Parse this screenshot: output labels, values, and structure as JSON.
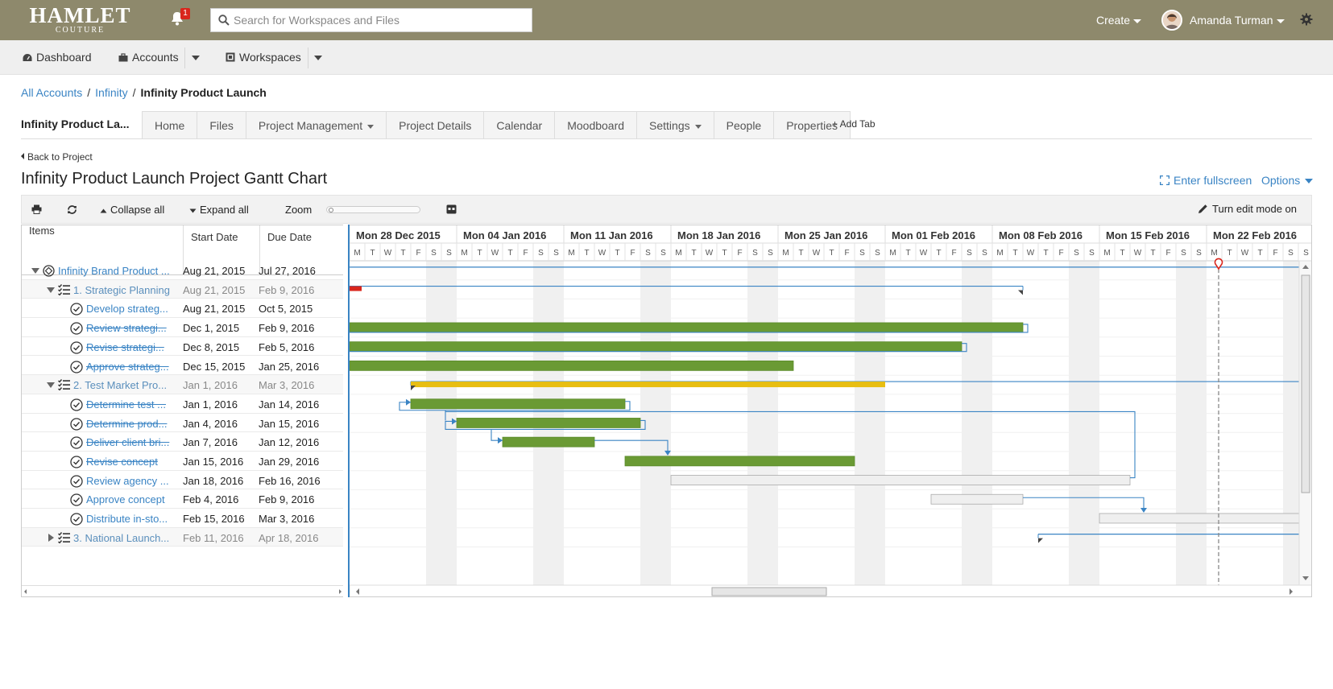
{
  "brand": {
    "line1": "HAMLET",
    "line2": "COUTURE"
  },
  "header": {
    "notifications_count": "1",
    "search_placeholder": "Search for Workspaces and Files",
    "create_label": "Create",
    "user_name": "Amanda Turman",
    "bar_color": "#8e896c"
  },
  "nav": {
    "dashboard": "Dashboard",
    "accounts": "Accounts",
    "workspaces": "Workspaces"
  },
  "breadcrumb": {
    "all_accounts": "All Accounts",
    "infinity": "Infinity",
    "current": "Infinity Product Launch"
  },
  "project": {
    "name": "Infinity Product La..."
  },
  "tabs": [
    {
      "label": "Home",
      "dropdown": false
    },
    {
      "label": "Files",
      "dropdown": false
    },
    {
      "label": "Project Management",
      "dropdown": true
    },
    {
      "label": "Project Details",
      "dropdown": false
    },
    {
      "label": "Calendar",
      "dropdown": false
    },
    {
      "label": "Moodboard",
      "dropdown": false
    },
    {
      "label": "Settings",
      "dropdown": true
    },
    {
      "label": "People",
      "dropdown": false
    },
    {
      "label": "Properties",
      "dropdown": false
    }
  ],
  "add_tab": "+ Add Tab",
  "back_link": "Back to Project",
  "page_title": "Infinity Product Launch Project Gantt Chart",
  "fullscreen": "Enter fullscreen",
  "options": "Options",
  "toolbar": {
    "collapse": "Collapse all",
    "expand": "Expand all",
    "zoom": "Zoom",
    "zoom_level": 0,
    "edit_mode": "Turn edit mode on"
  },
  "grid": {
    "headers": {
      "items": "Items",
      "start": "Start Date",
      "due": "Due Date"
    },
    "rows": [
      {
        "name": "Infinity Brand Product ...",
        "start": "Aug 21, 2015",
        "due": "Jul 27, 2016",
        "level": 0,
        "type": "root",
        "done": false
      },
      {
        "name": "1. Strategic Planning",
        "start": "Aug 21, 2015",
        "due": "Feb 9, 2016",
        "level": 1,
        "type": "group",
        "done": false
      },
      {
        "name": "Develop strateg...",
        "start": "Aug 21, 2015",
        "due": "Oct 5, 2015",
        "level": 2,
        "type": "task",
        "done": false
      },
      {
        "name": "Review strategi...",
        "start": "Dec 1, 2015",
        "due": "Feb 9, 2016",
        "level": 2,
        "type": "task",
        "done": true
      },
      {
        "name": "Revise strategi...",
        "start": "Dec 8, 2015",
        "due": "Feb 5, 2016",
        "level": 2,
        "type": "task",
        "done": true
      },
      {
        "name": "Approve strateg...",
        "start": "Dec 15, 2015",
        "due": "Jan 25, 2016",
        "level": 2,
        "type": "task",
        "done": true
      },
      {
        "name": "2. Test Market Pro...",
        "start": "Jan 1, 2016",
        "due": "Mar 3, 2016",
        "level": 1,
        "type": "group",
        "done": false
      },
      {
        "name": "Determine test ...",
        "start": "Jan 1, 2016",
        "due": "Jan 14, 2016",
        "level": 2,
        "type": "task",
        "done": true
      },
      {
        "name": "Determine prod...",
        "start": "Jan 4, 2016",
        "due": "Jan 15, 2016",
        "level": 2,
        "type": "task",
        "done": true
      },
      {
        "name": "Deliver client bri...",
        "start": "Jan 7, 2016",
        "due": "Jan 12, 2016",
        "level": 2,
        "type": "task",
        "done": true
      },
      {
        "name": "Revise concept",
        "start": "Jan 15, 2016",
        "due": "Jan 29, 2016",
        "level": 2,
        "type": "task",
        "done": true
      },
      {
        "name": "Review agency ...",
        "start": "Jan 18, 2016",
        "due": "Feb 16, 2016",
        "level": 2,
        "type": "task",
        "done": false
      },
      {
        "name": "Approve concept",
        "start": "Feb 4, 2016",
        "due": "Feb 9, 2016",
        "level": 2,
        "type": "task",
        "done": false
      },
      {
        "name": "Distribute in-sto...",
        "start": "Feb 15, 2016",
        "due": "Mar 3, 2016",
        "level": 2,
        "type": "task",
        "done": false
      },
      {
        "name": "3. National Launch...",
        "start": "Feb 11, 2016",
        "due": "Apr 18, 2016",
        "level": 1,
        "type": "group-closed",
        "done": false
      }
    ]
  },
  "timeline": {
    "weeks": [
      "Mon 28 Dec 2015",
      "Mon 04 Jan 2016",
      "Mon 11 Jan 2016",
      "Mon 18 Jan 2016",
      "Mon 25 Jan 2016",
      "Mon 01 Feb 2016",
      "Mon 08 Feb 2016",
      "Mon 15 Feb 2016",
      "Mon 22 Feb 2016"
    ],
    "day_letters": [
      "M",
      "T",
      "W",
      "T",
      "F",
      "S",
      "S"
    ],
    "colors": {
      "done": "#6a9a34",
      "in_progress": "#e8be12",
      "late": "#d9261c",
      "pending": "#efefef",
      "link": "#3a84c4",
      "today": "#888888"
    }
  }
}
